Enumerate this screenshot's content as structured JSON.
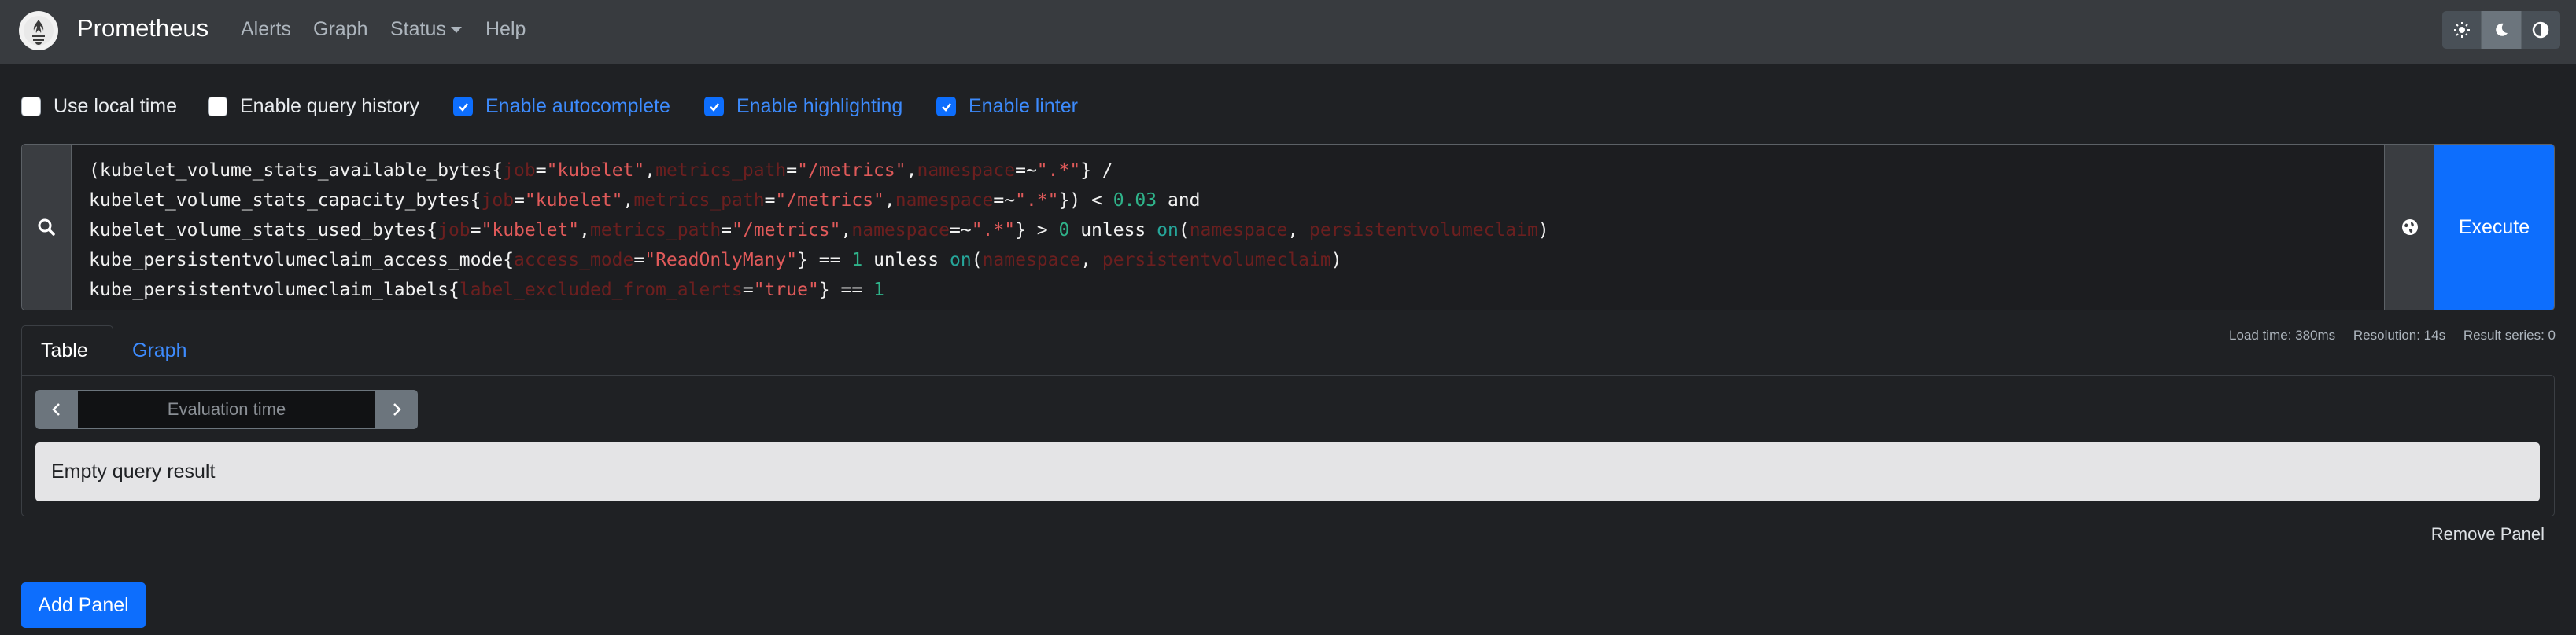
{
  "navbar": {
    "brand": "Prometheus",
    "links": [
      "Alerts",
      "Graph",
      "Status",
      "Help"
    ]
  },
  "options": {
    "use_local_time": {
      "label": "Use local time",
      "checked": false
    },
    "enable_query_history": {
      "label": "Enable query history",
      "checked": false
    },
    "enable_autocomplete": {
      "label": "Enable autocomplete",
      "checked": true
    },
    "enable_highlighting": {
      "label": "Enable highlighting",
      "checked": true
    },
    "enable_linter": {
      "label": "Enable linter",
      "checked": true
    }
  },
  "query": {
    "expression_lines": [
      "(kubelet_volume_stats_available_bytes{job=\"kubelet\",metrics_path=\"/metrics\",namespace=~\".*\"} /",
      "kubelet_volume_stats_capacity_bytes{job=\"kubelet\",metrics_path=\"/metrics\",namespace=~\".*\"}) < 0.03 and",
      "kubelet_volume_stats_used_bytes{job=\"kubelet\",metrics_path=\"/metrics\",namespace=~\".*\"} > 0 unless on(namespace, persistentvolumeclaim)",
      "kube_persistentvolumeclaim_access_mode{access_mode=\"ReadOnlyMany\"} == 1 unless on(namespace, persistentvolumeclaim)",
      "kube_persistentvolumeclaim_labels{label_excluded_from_alerts=\"true\"} == 1"
    ],
    "execute_label": "Execute"
  },
  "tabs": {
    "table": "Table",
    "graph": "Graph",
    "active": "table"
  },
  "stats": {
    "load_time": "Load time: 380ms",
    "resolution": "Resolution: 14s",
    "result_series": "Result series: 0"
  },
  "table": {
    "evaluation_time_placeholder": "Evaluation time",
    "empty_result": "Empty query result"
  },
  "remove_panel": "Remove Panel",
  "add_panel": "Add Panel",
  "colors": {
    "navbar": "#383b3f",
    "background": "#1f2124",
    "accent": "#0d6efd"
  }
}
